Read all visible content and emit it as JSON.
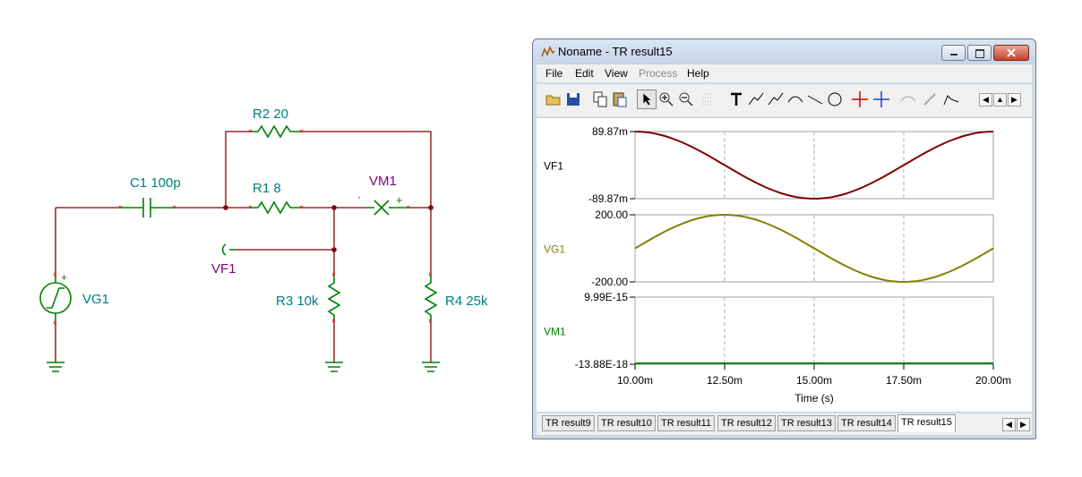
{
  "schematic": {
    "components": {
      "c1": "C1 100p",
      "r2": "R2 20",
      "r1": "R1 8",
      "vm1": "VM1",
      "vf1": "VF1",
      "vg1": "VG1",
      "r3": "R3 10k",
      "r4": "R4 25k"
    },
    "meter_signs": {
      "vm1_minus": "'",
      "vm1_plus": "+",
      "vg1_plus": "+"
    },
    "colors": {
      "wire": "#800000",
      "component": "#008000",
      "label_teal": "#008080",
      "label_purple": "#800080"
    }
  },
  "window": {
    "title": "Noname - TR result15",
    "menu": [
      "File",
      "Edit",
      "View",
      "Process",
      "Help"
    ],
    "menu_disabled": [
      "Process"
    ],
    "toolbar_icons": [
      "open-icon",
      "save-icon",
      "copy-icon",
      "paste-icon",
      "pointer-icon",
      "zoom-in-icon",
      "zoom-out-icon",
      "grid-icon",
      "text-icon",
      "curve-label-icon",
      "curve-label-alt-icon",
      "diagram-label-icon",
      "line-icon",
      "circle-icon",
      "cursor-a-icon",
      "cursor-b-icon",
      "smooth-icon",
      "pen-icon",
      "peak-icon"
    ],
    "tabs": [
      "TR result9",
      "TR result10",
      "TR result11",
      "TR result12",
      "TR result13",
      "TR result14",
      "TR result15"
    ],
    "active_tab": "TR result15"
  },
  "chart_data": [
    {
      "type": "line",
      "series": [
        {
          "name": "VF1",
          "color": "#800000",
          "x": [
            0.01,
            0.0125,
            0.015,
            0.0175,
            0.02
          ],
          "y": [
            0.08987,
            0,
            -0.08987,
            0,
            0.08987
          ]
        }
      ],
      "ylabels": [
        "89.87m",
        "-89.87m"
      ],
      "ylim": [
        -0.08987,
        0.08987
      ]
    },
    {
      "type": "line",
      "series": [
        {
          "name": "VG1",
          "color": "#808000",
          "x": [
            0.01,
            0.0125,
            0.015,
            0.0175,
            0.02
          ],
          "y": [
            0,
            200,
            0,
            -200,
            0
          ]
        }
      ],
      "ylabels": [
        "200.00",
        "-200.00"
      ],
      "ylim": [
        -200,
        200
      ]
    },
    {
      "type": "line",
      "series": [
        {
          "name": "VM1",
          "color": "#008000",
          "x": [
            0.01,
            0.02
          ],
          "y": [
            -1.388e-17,
            -1.388e-17
          ]
        }
      ],
      "ylabels": [
        "9.99E-15",
        "-13.88E-18"
      ]
    }
  ],
  "x_axis": {
    "ticks": [
      "10.00m",
      "12.50m",
      "15.00m",
      "17.50m",
      "20.00m"
    ],
    "label": "Time (s)",
    "xlim": [
      0.01,
      0.02
    ]
  }
}
